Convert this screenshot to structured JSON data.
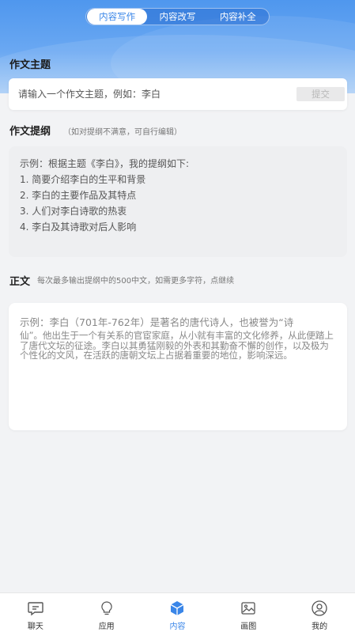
{
  "header": {
    "tabs": [
      {
        "label": "内容写作",
        "active": true
      },
      {
        "label": "内容改写",
        "active": false
      },
      {
        "label": "内容补全",
        "active": false
      }
    ]
  },
  "topic": {
    "title": "作文主题",
    "placeholder": "请输入一个作文主题，例如：李白",
    "submit_label": "提交"
  },
  "outline": {
    "title": "作文提纲",
    "hint": "（如对提纲不满意，可自行编辑）",
    "lines": [
      "示例：根据主题《李白》，我的提纲如下:",
      "1. 简要介绍李白的生平和背景",
      "2. 李白的主要作品及其特点",
      "3. 人们对李白诗歌的热衷",
      "4. 李白及其诗歌对后人影响"
    ]
  },
  "body": {
    "title": "正文",
    "hint": "每次最多输出提纲中的500中文，如需更多字符，点继续",
    "text_line1": "示例：李白（701年-762年）是著名的唐代诗人，也被誉为“诗",
    "text_line2": "仙”。他出生于一个有关系的官宦家庭，从小就有丰富的文化修养，从此便踏上了唐代文坛的征途。李白以其勇猛刚毅的外表和其勤奋不懈的创作，以及极为个性化的文风，在活跃的唐朝文坛上占据着重要的地位，影响深远。"
  },
  "tabbar": {
    "items": [
      {
        "label": "聊天",
        "icon": "chat-icon",
        "active": false
      },
      {
        "label": "应用",
        "icon": "bulb-icon",
        "active": false
      },
      {
        "label": "内容",
        "icon": "cube-icon",
        "active": true
      },
      {
        "label": "画图",
        "icon": "image-icon",
        "active": false
      },
      {
        "label": "我的",
        "icon": "user-icon",
        "active": false
      }
    ]
  },
  "colors": {
    "accent": "#3a86e8",
    "header_gradient_top": "#4f97ee",
    "header_gradient_bottom": "#a9cdf6",
    "background": "#f2f3f5"
  }
}
